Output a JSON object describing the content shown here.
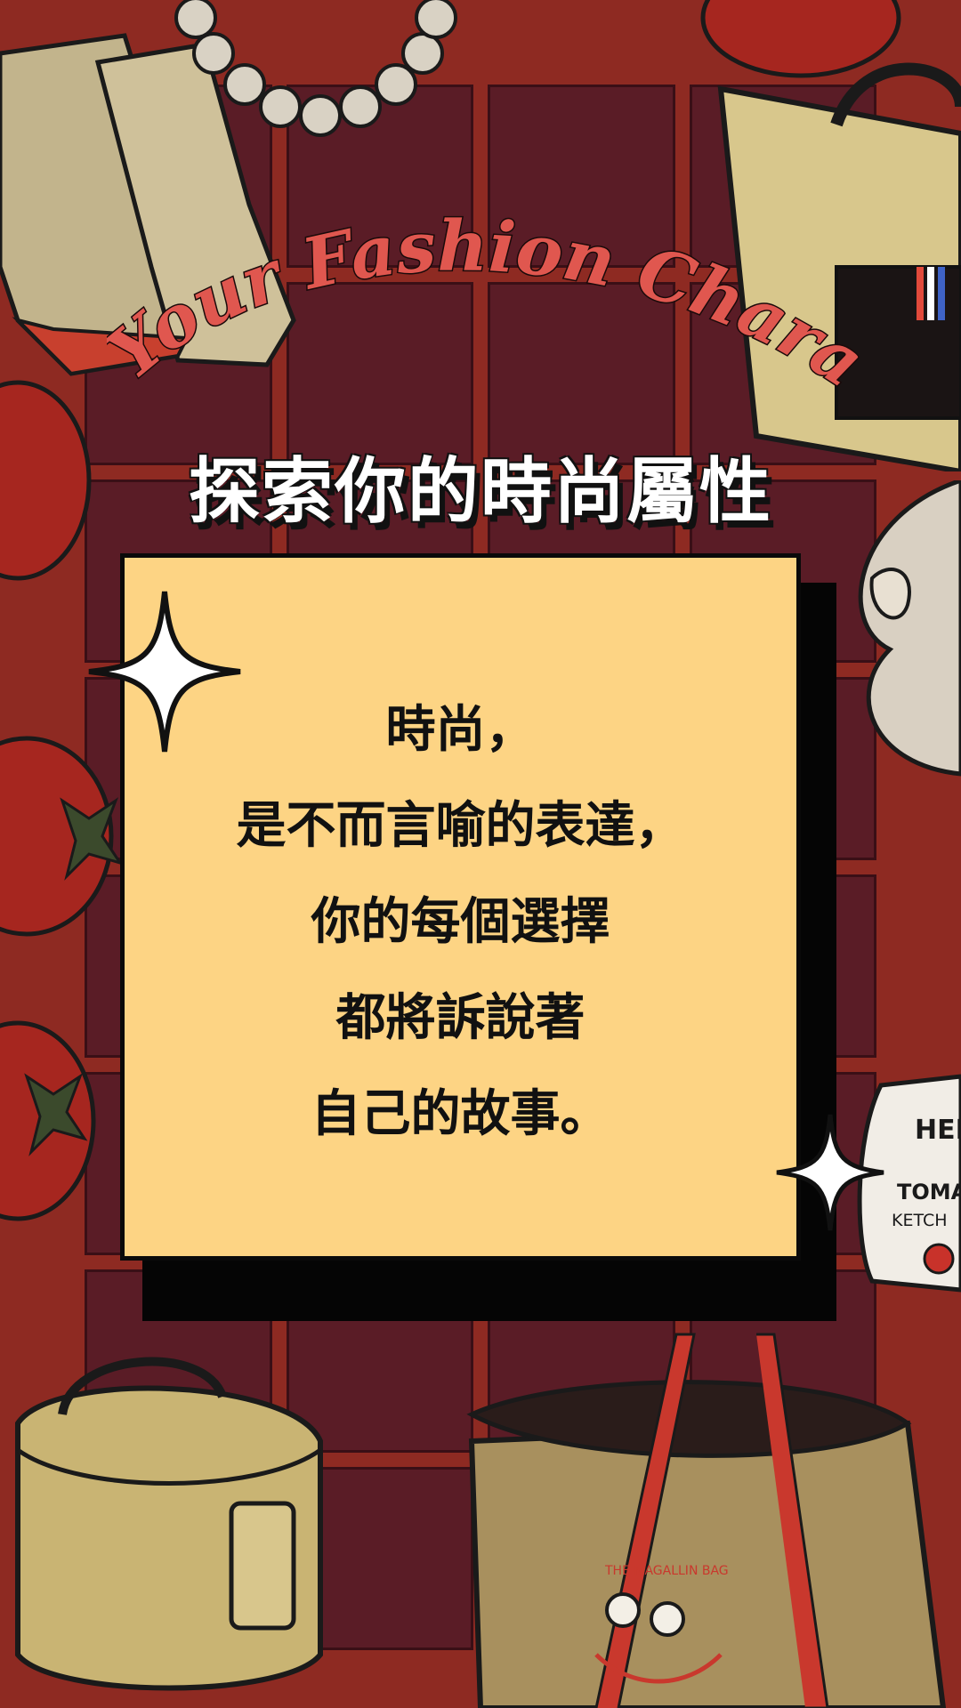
{
  "title_script": "Your Fashion Character",
  "heading": "探索你的時尚屬性",
  "quote_lines": [
    "時尚，",
    "是不而言喻的表達，",
    "你的每個選擇",
    "都將訴說著",
    "自己的故事。"
  ],
  "ketchup_label": {
    "brand": "HEI",
    "line1": "TOMA",
    "line2": "KETCH"
  },
  "bag_label": "THE MAGALLIN BAG",
  "colors": {
    "background": "#8e2a22",
    "grid": "#5a1c26",
    "card": "#fdd484",
    "title_script": "#e0574f",
    "heading": "#ffffff"
  }
}
